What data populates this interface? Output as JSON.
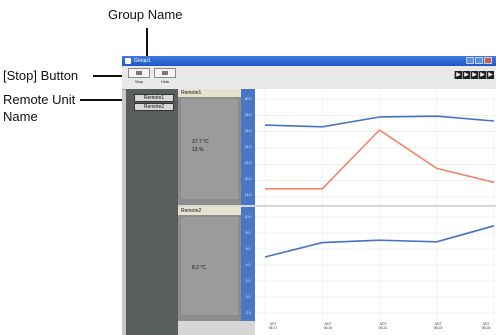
{
  "annotations": {
    "group_name": "Group Name",
    "stop_button": "[Stop] Button",
    "remote_unit_name_line1": "Remote Unit",
    "remote_unit_name_line2": "Name"
  },
  "window": {
    "title": "Group1",
    "toolbar": {
      "stop_label": "Stop",
      "hide_label": "Hide"
    },
    "nav_arrows": [
      "▶",
      "▶",
      "▶",
      "▶",
      "▶"
    ]
  },
  "sidebar": {
    "remotes": [
      {
        "label": "Remote1"
      },
      {
        "label": "Remote2"
      }
    ]
  },
  "panels": [
    {
      "name": "Remote1",
      "readings": [
        "27.7 °C",
        "13 %"
      ],
      "y_ticks": [
        "30.0",
        "28.0",
        "26.0",
        "24.0",
        "22.0",
        "20.0",
        "18.0"
      ]
    },
    {
      "name": "Remote2",
      "readings": [
        "8.2 °C"
      ],
      "y_ticks": [
        "10.0",
        "8.0",
        "6.0",
        "4.0",
        "2.0",
        "0.0",
        "-2.0"
      ]
    }
  ],
  "x_ticks": [
    {
      "date": "3/07",
      "time": "06:17"
    },
    {
      "date": "3/07",
      "time": "06:19"
    },
    {
      "date": "3/07",
      "time": "06:21"
    },
    {
      "date": "3/07",
      "time": "06:23"
    },
    {
      "date": "3/07",
      "time": "06:25"
    }
  ],
  "colors": {
    "temperature": "#4672c4",
    "humidity": "#f2836b",
    "axis_band": "#4977c6",
    "sidebar": "#5a5d5e"
  },
  "chart_data": [
    {
      "type": "line",
      "ylim": [
        18,
        30
      ],
      "series": [
        {
          "values": [
            26.8,
            26.6,
            27.8,
            27.9,
            27.3
          ]
        },
        {
          "values": [
            19.0,
            19.0,
            26.2,
            21.5,
            19.8
          ]
        }
      ]
    },
    {
      "type": "line",
      "ylim": [
        -2,
        10
      ],
      "series": [
        {
          "values": [
            5.0,
            6.8,
            7.1,
            6.9,
            8.9
          ]
        }
      ]
    }
  ]
}
